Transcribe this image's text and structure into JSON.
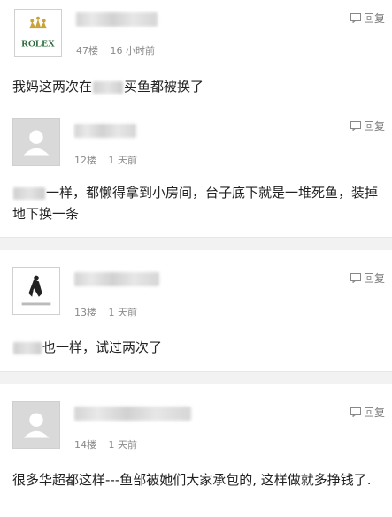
{
  "reply_label": "回复",
  "comments": [
    {
      "avatar": "rolex-logo",
      "avatar_text": "ROLEX",
      "floor": "47楼",
      "time": "16 小时前",
      "text_before": "我妈这两次在",
      "text_after": "买鱼都被换了"
    },
    {
      "avatar": "default-user-icon",
      "floor": "12楼",
      "time": "1 天前",
      "text_after": "一样，都懒得拿到小房间，台子底下就是一堆死鱼，装掉地下换一条"
    },
    {
      "avatar": "custom-image",
      "floor": "13楼",
      "time": "1 天前",
      "text_after": "也一样，试过两次了"
    },
    {
      "avatar": "default-user-icon",
      "floor": "14楼",
      "time": "1 天前",
      "text": "很多华超都这样---鱼部被她们大家承包的, 这样做就多挣钱了."
    }
  ]
}
